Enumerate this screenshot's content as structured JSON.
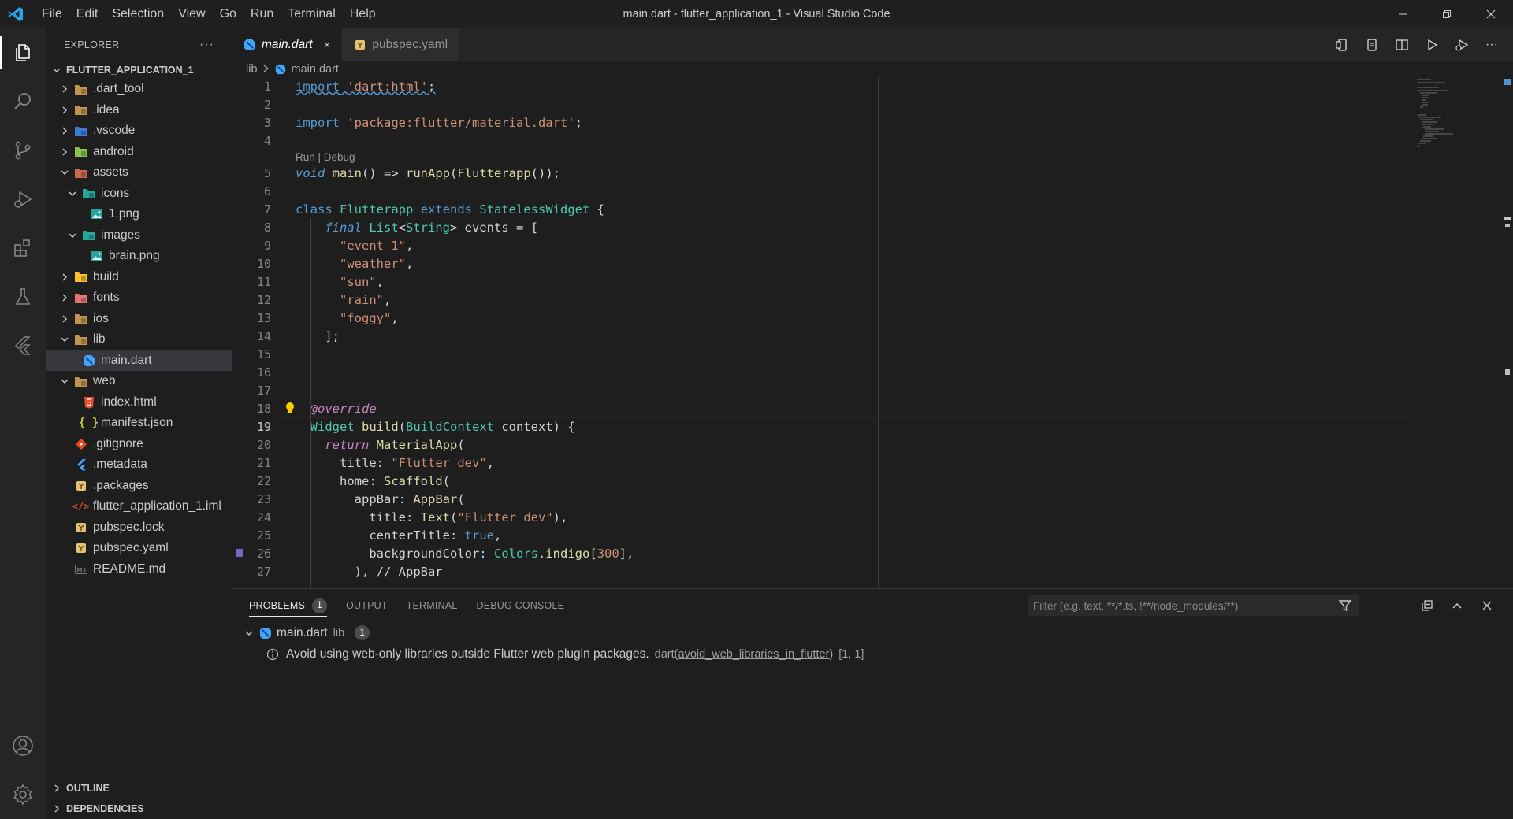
{
  "window": {
    "title": "main.dart - flutter_application_1 - Visual Studio Code",
    "menu": [
      "File",
      "Edit",
      "Selection",
      "View",
      "Go",
      "Run",
      "Terminal",
      "Help"
    ]
  },
  "activity_bar": {
    "items": [
      "explorer-icon",
      "search-icon",
      "source-control-icon",
      "run-debug-icon",
      "extensions-icon",
      "testing-icon",
      "flutter-icon"
    ],
    "bottom": [
      "account-icon",
      "settings-gear-icon"
    ]
  },
  "sidebar": {
    "title": "EXPLORER",
    "more": "···",
    "root": "FLUTTER_APPLICATION_1",
    "tree": [
      {
        "label": ".dart_tool",
        "depth": 0,
        "chevron": "right",
        "icon": "folder",
        "color": "#c09553"
      },
      {
        "label": ".idea",
        "depth": 0,
        "chevron": "right",
        "icon": "folder-idea",
        "color": "#c09553"
      },
      {
        "label": ".vscode",
        "depth": 0,
        "chevron": "right",
        "icon": "folder-vscode",
        "color": "#3a7bd5"
      },
      {
        "label": "android",
        "depth": 0,
        "chevron": "right",
        "icon": "folder-android",
        "color": "#8bc34a"
      },
      {
        "label": "assets",
        "depth": 0,
        "chevron": "down",
        "icon": "folder-assets",
        "color": "#c96b4a"
      },
      {
        "label": "icons",
        "depth": 1,
        "chevron": "down",
        "icon": "folder-images",
        "color": "#26a69a"
      },
      {
        "label": "1.png",
        "depth": 2,
        "chevron": "",
        "icon": "image",
        "color": "#26a69a"
      },
      {
        "label": "images",
        "depth": 1,
        "chevron": "down",
        "icon": "folder-images",
        "color": "#26a69a"
      },
      {
        "label": "brain.png",
        "depth": 2,
        "chevron": "",
        "icon": "image",
        "color": "#26a69a"
      },
      {
        "label": "build",
        "depth": 0,
        "chevron": "right",
        "icon": "folder-build",
        "color": "#fbc02d"
      },
      {
        "label": "fonts",
        "depth": 0,
        "chevron": "right",
        "icon": "folder-fonts",
        "color": "#e57373"
      },
      {
        "label": "ios",
        "depth": 0,
        "chevron": "right",
        "icon": "folder-ios",
        "color": "#c09553"
      },
      {
        "label": "lib",
        "depth": 0,
        "chevron": "down",
        "icon": "folder-lib",
        "color": "#c09553"
      },
      {
        "label": "main.dart",
        "depth": 1,
        "chevron": "",
        "icon": "dart",
        "color": "#42a5f5",
        "selected": true
      },
      {
        "label": "web",
        "depth": 0,
        "chevron": "down",
        "icon": "folder-web",
        "color": "#c09553"
      },
      {
        "label": "index.html",
        "depth": 1,
        "chevron": "",
        "icon": "html",
        "color": "#e44d26"
      },
      {
        "label": "manifest.json",
        "depth": 1,
        "chevron": "",
        "icon": "json",
        "color": "#cbcb41"
      },
      {
        "label": ".gitignore",
        "depth": 0,
        "chevron": "",
        "icon": "git",
        "color": "#e64a19"
      },
      {
        "label": ".metadata",
        "depth": 0,
        "chevron": "",
        "icon": "flutter",
        "color": "#42a5f5"
      },
      {
        "label": ".packages",
        "depth": 0,
        "chevron": "",
        "icon": "yaml",
        "color": "#e8c274"
      },
      {
        "label": "flutter_application_1.iml",
        "depth": 0,
        "chevron": "",
        "icon": "xml",
        "color": "#e44d26"
      },
      {
        "label": "pubspec.lock",
        "depth": 0,
        "chevron": "",
        "icon": "yaml",
        "color": "#e8c274"
      },
      {
        "label": "pubspec.yaml",
        "depth": 0,
        "chevron": "",
        "icon": "yaml",
        "color": "#e8c274"
      },
      {
        "label": "README.md",
        "depth": 0,
        "chevron": "",
        "icon": "markdown",
        "color": "#7a7a7a"
      }
    ],
    "footer": [
      "OUTLINE",
      "DEPENDENCIES"
    ]
  },
  "editor": {
    "tabs": [
      {
        "label": "main.dart",
        "active": true,
        "close": "×"
      },
      {
        "label": "pubspec.yaml",
        "active": false
      }
    ],
    "breadcrumb": [
      "lib",
      "main.dart"
    ],
    "codelens": "Run | Debug",
    "current_line": 19,
    "lines": [
      {
        "n": 1,
        "tokens": [
          [
            "kw",
            "import"
          ],
          [
            "",
            " "
          ],
          [
            "str",
            "'dart:html'"
          ],
          [
            "",
            ";"
          ]
        ]
      },
      {
        "n": 2,
        "tokens": []
      },
      {
        "n": 3,
        "tokens": [
          [
            "kw",
            "import"
          ],
          [
            "",
            " "
          ],
          [
            "str",
            "'package:flutter/material.dart'"
          ],
          [
            "",
            ";"
          ]
        ]
      },
      {
        "n": 4,
        "tokens": []
      },
      {
        "n": 5,
        "tokens": [
          [
            "kwi",
            "void"
          ],
          [
            "",
            " "
          ],
          [
            "fn",
            "main"
          ],
          [
            "",
            "() => "
          ],
          [
            "fn",
            "runApp"
          ],
          [
            "",
            "("
          ],
          [
            "fn",
            "Flutterapp"
          ],
          [
            "",
            "());"
          ]
        ]
      },
      {
        "n": 6,
        "tokens": []
      },
      {
        "n": 7,
        "tokens": [
          [
            "kw",
            "class"
          ],
          [
            "",
            " "
          ],
          [
            "typ",
            "Flutterapp"
          ],
          [
            "",
            " "
          ],
          [
            "kw",
            "extends"
          ],
          [
            "",
            " "
          ],
          [
            "typ",
            "StatelessWidget"
          ],
          [
            "",
            " {"
          ]
        ]
      },
      {
        "n": 8,
        "tokens": [
          [
            "",
            "    "
          ],
          [
            "kwi",
            "final"
          ],
          [
            "",
            " "
          ],
          [
            "typ",
            "List"
          ],
          [
            "",
            "<"
          ],
          [
            "typ",
            "String"
          ],
          [
            "",
            "> events = ["
          ]
        ]
      },
      {
        "n": 9,
        "tokens": [
          [
            "",
            "      "
          ],
          [
            "str",
            "\"event 1\""
          ],
          [
            "",
            ","
          ]
        ]
      },
      {
        "n": 10,
        "tokens": [
          [
            "",
            "      "
          ],
          [
            "str",
            "\"weather\""
          ],
          [
            "",
            ","
          ]
        ]
      },
      {
        "n": 11,
        "tokens": [
          [
            "",
            "      "
          ],
          [
            "str",
            "\"sun\""
          ],
          [
            "",
            ","
          ]
        ]
      },
      {
        "n": 12,
        "tokens": [
          [
            "",
            "      "
          ],
          [
            "str",
            "\"rain\""
          ],
          [
            "",
            ","
          ]
        ]
      },
      {
        "n": 13,
        "tokens": [
          [
            "",
            "      "
          ],
          [
            "str",
            "\"foggy\""
          ],
          [
            "",
            ","
          ]
        ]
      },
      {
        "n": 14,
        "tokens": [
          [
            "",
            "    ];"
          ]
        ]
      },
      {
        "n": 15,
        "tokens": []
      },
      {
        "n": 16,
        "tokens": []
      },
      {
        "n": 17,
        "tokens": []
      },
      {
        "n": 18,
        "tokens": [
          [
            "",
            "  "
          ],
          [
            "ann",
            "@override"
          ]
        ]
      },
      {
        "n": 19,
        "tokens": [
          [
            "",
            "  "
          ],
          [
            "typ",
            "Widget"
          ],
          [
            "",
            " "
          ],
          [
            "fn",
            "build"
          ],
          [
            "",
            "("
          ],
          [
            "typ",
            "BuildContext"
          ],
          [
            "",
            " context) {"
          ]
        ]
      },
      {
        "n": 20,
        "tokens": [
          [
            "",
            "    "
          ],
          [
            "ctl",
            "return"
          ],
          [
            "",
            " "
          ],
          [
            "fn",
            "MaterialApp"
          ],
          [
            "",
            "("
          ]
        ]
      },
      {
        "n": 21,
        "tokens": [
          [
            "",
            "      title"
          ],
          [
            "prop",
            ":"
          ],
          [
            "",
            " "
          ],
          [
            "str",
            "\"Flutter dev\""
          ],
          [
            "",
            ","
          ]
        ]
      },
      {
        "n": 22,
        "tokens": [
          [
            "",
            "      home"
          ],
          [
            "prop",
            ":"
          ],
          [
            "",
            " "
          ],
          [
            "fn",
            "Scaffold"
          ],
          [
            "",
            "("
          ]
        ]
      },
      {
        "n": 23,
        "tokens": [
          [
            "",
            "        appBar"
          ],
          [
            "prop",
            ":"
          ],
          [
            "",
            " "
          ],
          [
            "fn",
            "AppBar"
          ],
          [
            "",
            "("
          ]
        ]
      },
      {
        "n": 24,
        "tokens": [
          [
            "",
            "          title"
          ],
          [
            "prop",
            ":"
          ],
          [
            "",
            " "
          ],
          [
            "fn",
            "Text"
          ],
          [
            "",
            "("
          ],
          [
            "str",
            "\"Flutter dev\""
          ],
          [
            "",
            "),"
          ]
        ]
      },
      {
        "n": 25,
        "tokens": [
          [
            "",
            "          centerTitle"
          ],
          [
            "prop",
            ":"
          ],
          [
            "",
            " "
          ],
          [
            "kw",
            "true"
          ],
          [
            "",
            ","
          ]
        ]
      },
      {
        "n": 26,
        "tokens": [
          [
            "",
            "          backgroundColor"
          ],
          [
            "prop",
            ":"
          ],
          [
            "",
            " "
          ],
          [
            "typ",
            "Colors"
          ],
          [
            "",
            "."
          ],
          [
            "fn",
            "indigo"
          ],
          [
            "",
            "["
          ],
          [
            "str",
            "300"
          ],
          [
            "",
            "],"
          ]
        ]
      },
      {
        "n": 27,
        "tokens": [
          [
            "",
            "        ), "
          ],
          [
            "",
            "// AppBar"
          ]
        ]
      }
    ]
  },
  "panel": {
    "tabs": [
      {
        "label": "PROBLEMS",
        "active": true,
        "badge": "1"
      },
      {
        "label": "OUTPUT",
        "active": false
      },
      {
        "label": "TERMINAL",
        "active": false
      },
      {
        "label": "DEBUG CONSOLE",
        "active": false
      }
    ],
    "filter_placeholder": "Filter (e.g. text, **/*.ts, !**/node_modules/**)",
    "problems": {
      "file": "main.dart",
      "folder": "lib",
      "count": "1",
      "message": "Avoid using web-only libraries outside Flutter web plugin packages.",
      "source": "dart(",
      "code": "avoid_web_libraries_in_flutter",
      "source_end": ")",
      "position": "[1, 1]"
    }
  },
  "colors": {
    "accent": "#007acc",
    "background": "#1e1e1e",
    "sidebar_selected": "#37373d"
  }
}
